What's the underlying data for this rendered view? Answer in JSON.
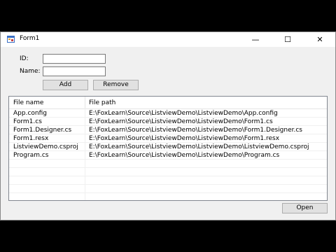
{
  "window": {
    "title": "Form1",
    "minimize_glyph": "—",
    "maximize_glyph": "☐",
    "close_glyph": "✕"
  },
  "form": {
    "id_label": "ID:",
    "id_value": "",
    "name_label": "Name:",
    "name_value": "",
    "add_label": "Add",
    "remove_label": "Remove",
    "open_label": "Open"
  },
  "listview": {
    "columns": [
      "File name",
      "File path"
    ],
    "rows": [
      [
        "App.config",
        "E:\\FoxLearn\\Source\\ListviewDemo\\ListviewDemo\\App.config"
      ],
      [
        "Form1.cs",
        "E:\\FoxLearn\\Source\\ListviewDemo\\ListviewDemo\\Form1.cs"
      ],
      [
        "Form1.Designer.cs",
        "E:\\FoxLearn\\Source\\ListviewDemo\\ListviewDemo\\Form1.Designer.cs"
      ],
      [
        "Form1.resx",
        "E:\\FoxLearn\\Source\\ListviewDemo\\ListviewDemo\\Form1.resx"
      ],
      [
        "ListviewDemo.csproj",
        "E:\\FoxLearn\\Source\\ListviewDemo\\ListviewDemo\\ListviewDemo.csproj"
      ],
      [
        "Program.cs",
        "E:\\FoxLearn\\Source\\ListviewDemo\\ListviewDemo\\Program.cs"
      ]
    ]
  },
  "icons": {
    "app": "form-app-icon"
  }
}
